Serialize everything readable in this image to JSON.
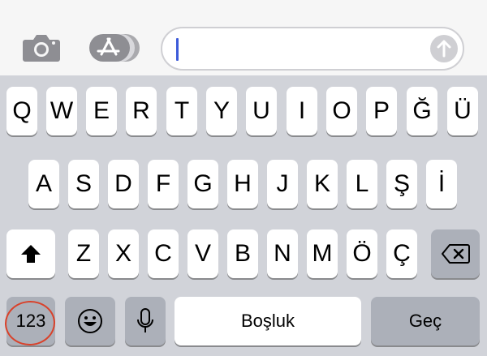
{
  "message_bar": {
    "input_value": "",
    "input_placeholder": ""
  },
  "keyboard": {
    "row1": [
      "Q",
      "W",
      "E",
      "R",
      "T",
      "Y",
      "U",
      "I",
      "O",
      "P",
      "Ğ",
      "Ü"
    ],
    "row2": [
      "A",
      "S",
      "D",
      "F",
      "G",
      "H",
      "J",
      "K",
      "L",
      "Ş",
      "İ"
    ],
    "row3": [
      "Z",
      "X",
      "C",
      "V",
      "B",
      "N",
      "M",
      "Ö",
      "Ç"
    ],
    "numbers_label": "123",
    "space_label": "Boşluk",
    "return_label": "Geç"
  },
  "colors": {
    "keyboard_bg": "#d1d3d9",
    "key_bg": "#ffffff",
    "function_key_bg": "#acb0b9",
    "caret": "#3d5bd9",
    "annotation_circle": "#d9412a"
  },
  "icons": [
    "camera-icon",
    "app-store-icon",
    "send-arrow-icon",
    "shift-icon",
    "delete-icon",
    "emoji-icon",
    "microphone-icon"
  ]
}
